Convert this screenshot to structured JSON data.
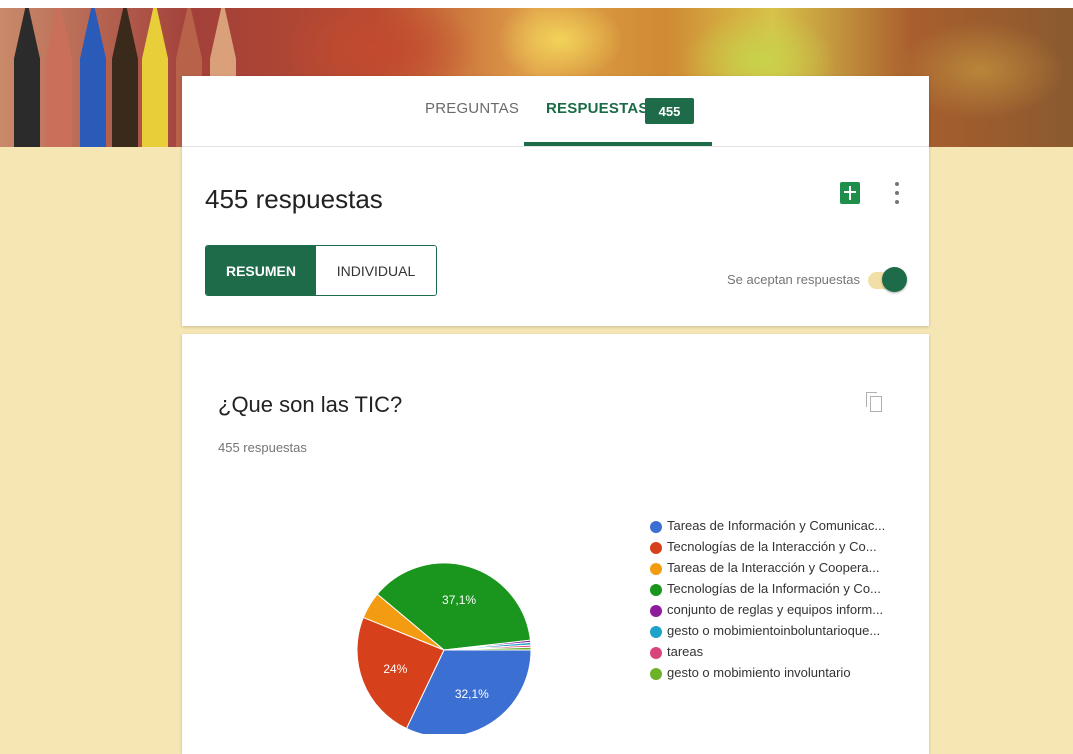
{
  "tabs": {
    "preguntas": "PREGUNTAS",
    "respuestas": "RESPUESTAS",
    "badge": "455"
  },
  "header": {
    "count_title": "455 respuestas",
    "accepting_label": "Se aceptan respuestas"
  },
  "view_toggle": {
    "resumen": "RESUMEN",
    "individual": "INDIVIDUAL"
  },
  "question": {
    "title": "¿Que son las TIC?",
    "responses": "455 respuestas"
  },
  "icons": [
    "sheets-icon",
    "more-vert-icon",
    "copy-icon"
  ],
  "colors": {
    "brand_green": "#1e6b49",
    "background": "#f6e6b3"
  },
  "chart_data": {
    "type": "pie",
    "slices": [
      {
        "label": "Tareas de Información y Comunicac...",
        "color": "#3b6fd1",
        "value": 32.1,
        "display": "32,1%"
      },
      {
        "label": "Tecnologías de la Interacción y Co...",
        "color": "#d6401b",
        "value": 24.0,
        "display": "24%"
      },
      {
        "label": "Tareas de la Interacción y Coopera...",
        "color": "#f39c12",
        "value": 5.0,
        "display": ""
      },
      {
        "label": "Tecnologías de la Información y Co...",
        "color": "#1a961e",
        "value": 37.1,
        "display": "37,1%"
      },
      {
        "label": "conjunto de reglas y equipos inform...",
        "color": "#8e1b9c",
        "value": 0.4,
        "display": ""
      },
      {
        "label": "gesto o mobimientoinboluntarioque...",
        "color": "#1fa3c8",
        "value": 0.5,
        "display": ""
      },
      {
        "label": "tareas",
        "color": "#d9457b",
        "value": 0.4,
        "display": ""
      },
      {
        "label": "gesto o mobimiento involuntario",
        "color": "#6cb329",
        "value": 0.5,
        "display": ""
      }
    ]
  }
}
